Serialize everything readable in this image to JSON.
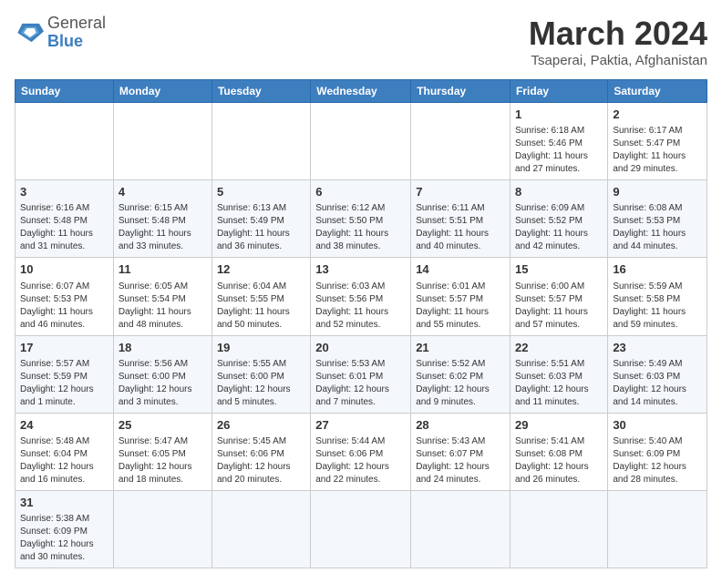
{
  "header": {
    "logo_general": "General",
    "logo_blue": "Blue",
    "title": "March 2024",
    "subtitle": "Tsaperai, Paktia, Afghanistan"
  },
  "days_of_week": [
    "Sunday",
    "Monday",
    "Tuesday",
    "Wednesday",
    "Thursday",
    "Friday",
    "Saturday"
  ],
  "weeks": [
    [
      {
        "day": "",
        "info": ""
      },
      {
        "day": "",
        "info": ""
      },
      {
        "day": "",
        "info": ""
      },
      {
        "day": "",
        "info": ""
      },
      {
        "day": "",
        "info": ""
      },
      {
        "day": "1",
        "info": "Sunrise: 6:18 AM\nSunset: 5:46 PM\nDaylight: 11 hours and 27 minutes."
      },
      {
        "day": "2",
        "info": "Sunrise: 6:17 AM\nSunset: 5:47 PM\nDaylight: 11 hours and 29 minutes."
      }
    ],
    [
      {
        "day": "3",
        "info": "Sunrise: 6:16 AM\nSunset: 5:48 PM\nDaylight: 11 hours and 31 minutes."
      },
      {
        "day": "4",
        "info": "Sunrise: 6:15 AM\nSunset: 5:48 PM\nDaylight: 11 hours and 33 minutes."
      },
      {
        "day": "5",
        "info": "Sunrise: 6:13 AM\nSunset: 5:49 PM\nDaylight: 11 hours and 36 minutes."
      },
      {
        "day": "6",
        "info": "Sunrise: 6:12 AM\nSunset: 5:50 PM\nDaylight: 11 hours and 38 minutes."
      },
      {
        "day": "7",
        "info": "Sunrise: 6:11 AM\nSunset: 5:51 PM\nDaylight: 11 hours and 40 minutes."
      },
      {
        "day": "8",
        "info": "Sunrise: 6:09 AM\nSunset: 5:52 PM\nDaylight: 11 hours and 42 minutes."
      },
      {
        "day": "9",
        "info": "Sunrise: 6:08 AM\nSunset: 5:53 PM\nDaylight: 11 hours and 44 minutes."
      }
    ],
    [
      {
        "day": "10",
        "info": "Sunrise: 6:07 AM\nSunset: 5:53 PM\nDaylight: 11 hours and 46 minutes."
      },
      {
        "day": "11",
        "info": "Sunrise: 6:05 AM\nSunset: 5:54 PM\nDaylight: 11 hours and 48 minutes."
      },
      {
        "day": "12",
        "info": "Sunrise: 6:04 AM\nSunset: 5:55 PM\nDaylight: 11 hours and 50 minutes."
      },
      {
        "day": "13",
        "info": "Sunrise: 6:03 AM\nSunset: 5:56 PM\nDaylight: 11 hours and 52 minutes."
      },
      {
        "day": "14",
        "info": "Sunrise: 6:01 AM\nSunset: 5:57 PM\nDaylight: 11 hours and 55 minutes."
      },
      {
        "day": "15",
        "info": "Sunrise: 6:00 AM\nSunset: 5:57 PM\nDaylight: 11 hours and 57 minutes."
      },
      {
        "day": "16",
        "info": "Sunrise: 5:59 AM\nSunset: 5:58 PM\nDaylight: 11 hours and 59 minutes."
      }
    ],
    [
      {
        "day": "17",
        "info": "Sunrise: 5:57 AM\nSunset: 5:59 PM\nDaylight: 12 hours and 1 minute."
      },
      {
        "day": "18",
        "info": "Sunrise: 5:56 AM\nSunset: 6:00 PM\nDaylight: 12 hours and 3 minutes."
      },
      {
        "day": "19",
        "info": "Sunrise: 5:55 AM\nSunset: 6:00 PM\nDaylight: 12 hours and 5 minutes."
      },
      {
        "day": "20",
        "info": "Sunrise: 5:53 AM\nSunset: 6:01 PM\nDaylight: 12 hours and 7 minutes."
      },
      {
        "day": "21",
        "info": "Sunrise: 5:52 AM\nSunset: 6:02 PM\nDaylight: 12 hours and 9 minutes."
      },
      {
        "day": "22",
        "info": "Sunrise: 5:51 AM\nSunset: 6:03 PM\nDaylight: 12 hours and 11 minutes."
      },
      {
        "day": "23",
        "info": "Sunrise: 5:49 AM\nSunset: 6:03 PM\nDaylight: 12 hours and 14 minutes."
      }
    ],
    [
      {
        "day": "24",
        "info": "Sunrise: 5:48 AM\nSunset: 6:04 PM\nDaylight: 12 hours and 16 minutes."
      },
      {
        "day": "25",
        "info": "Sunrise: 5:47 AM\nSunset: 6:05 PM\nDaylight: 12 hours and 18 minutes."
      },
      {
        "day": "26",
        "info": "Sunrise: 5:45 AM\nSunset: 6:06 PM\nDaylight: 12 hours and 20 minutes."
      },
      {
        "day": "27",
        "info": "Sunrise: 5:44 AM\nSunset: 6:06 PM\nDaylight: 12 hours and 22 minutes."
      },
      {
        "day": "28",
        "info": "Sunrise: 5:43 AM\nSunset: 6:07 PM\nDaylight: 12 hours and 24 minutes."
      },
      {
        "day": "29",
        "info": "Sunrise: 5:41 AM\nSunset: 6:08 PM\nDaylight: 12 hours and 26 minutes."
      },
      {
        "day": "30",
        "info": "Sunrise: 5:40 AM\nSunset: 6:09 PM\nDaylight: 12 hours and 28 minutes."
      }
    ],
    [
      {
        "day": "31",
        "info": "Sunrise: 5:38 AM\nSunset: 6:09 PM\nDaylight: 12 hours and 30 minutes."
      },
      {
        "day": "",
        "info": ""
      },
      {
        "day": "",
        "info": ""
      },
      {
        "day": "",
        "info": ""
      },
      {
        "day": "",
        "info": ""
      },
      {
        "day": "",
        "info": ""
      },
      {
        "day": "",
        "info": ""
      }
    ]
  ]
}
